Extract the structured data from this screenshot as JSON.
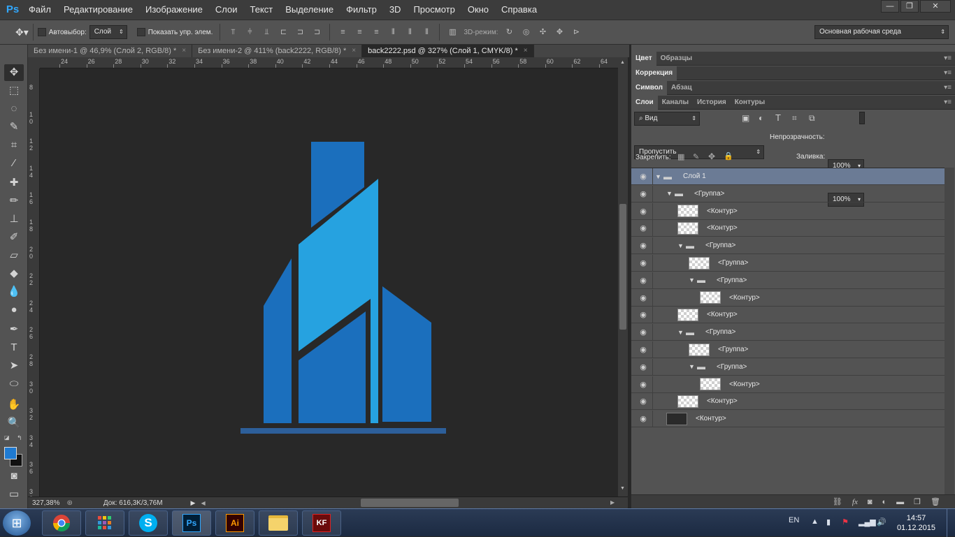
{
  "app": {
    "logo": "Ps",
    "menu": [
      "Файл",
      "Редактирование",
      "Изображение",
      "Слои",
      "Текст",
      "Выделение",
      "Фильтр",
      "3D",
      "Просмотр",
      "Окно",
      "Справка"
    ]
  },
  "options": {
    "autoselect_label": "Автовыбор:",
    "autoselect_value": "Слой",
    "show_transform_label": "Показать упр. элем.",
    "mode3d_label": "3D-режим:",
    "workspace": "Основная рабочая среда"
  },
  "tabs": [
    {
      "label": "Без имени-1 @ 46,9% (Слой 2, RGB/8) *",
      "close": "×"
    },
    {
      "label": "Без имени-2 @ 411% (back2222, RGB/8) *",
      "close": "×"
    },
    {
      "label": "back2222.psd @ 327% (Слой 1, CMYK/8) *",
      "close": "×"
    }
  ],
  "ruler": {
    "top": [
      "24",
      "26",
      "28",
      "30",
      "32",
      "34",
      "36",
      "38",
      "40",
      "42",
      "44",
      "46",
      "48",
      "50",
      "52",
      "54",
      "56",
      "58",
      "60",
      "62",
      "64"
    ],
    "left": [
      "8",
      "1\n0",
      "1\n2",
      "1\n4",
      "1\n6",
      "1\n8",
      "2\n0",
      "2\n2",
      "2\n4",
      "2\n6",
      "2\n8",
      "3\n0",
      "3\n2",
      "3\n4",
      "3\n6",
      "3\n8"
    ]
  },
  "status": {
    "zoom": "327,38%",
    "doc": "Док: 616,3K/3,76M"
  },
  "panels": {
    "color_tabs": [
      "Цвет",
      "Образцы"
    ],
    "adjust_tabs": [
      "Коррекция"
    ],
    "char_tabs": [
      "Символ",
      "Абзац"
    ],
    "layer_tabs": [
      "Слои",
      "Каналы",
      "История",
      "Контуры"
    ],
    "filter_kind": "Вид",
    "blend_mode": "Пропустить",
    "opacity_label": "Непрозрачность:",
    "opacity_value": "100%",
    "lock_label": "Закрепить:",
    "fill_label": "Заливка:",
    "fill_value": "100%"
  },
  "layers": [
    {
      "name": "Слой 1",
      "type": "folder",
      "depth": 0,
      "open": true,
      "selected": true
    },
    {
      "name": "<Группа>",
      "type": "folder",
      "depth": 1,
      "open": true
    },
    {
      "name": "<Контур>",
      "type": "layer",
      "depth": 2
    },
    {
      "name": "<Контур>",
      "type": "layer",
      "depth": 2
    },
    {
      "name": "<Группа>",
      "type": "folder",
      "depth": 2,
      "open": true
    },
    {
      "name": "<Группа>",
      "type": "layer",
      "depth": 3
    },
    {
      "name": "<Группа>",
      "type": "folder",
      "depth": 3,
      "open": true
    },
    {
      "name": "<Контур>",
      "type": "layer",
      "depth": 4
    },
    {
      "name": "<Контур>",
      "type": "layer",
      "depth": 2
    },
    {
      "name": "<Группа>",
      "type": "folder",
      "depth": 2,
      "open": true
    },
    {
      "name": "<Группа>",
      "type": "layer",
      "depth": 3
    },
    {
      "name": "<Группа>",
      "type": "folder",
      "depth": 3,
      "open": true
    },
    {
      "name": "<Контур>",
      "type": "layer",
      "depth": 4
    },
    {
      "name": "<Контур>",
      "type": "layer",
      "depth": 2
    },
    {
      "name": "<Контур>",
      "type": "layer",
      "depth": 1,
      "dark": true
    }
  ],
  "taskbar": {
    "lang": "EN",
    "time": "14:57",
    "date": "01.12.2015",
    "apps": [
      "chrome",
      "metro",
      "skype",
      "Ps",
      "Ai",
      "folder",
      "KF"
    ]
  },
  "colors": {
    "fg": "#1f7ad1",
    "bg": "#111111",
    "logo_dark": "#1b6fbd",
    "logo_light": "#26a2e0",
    "logo_base": "#2d5f9a"
  }
}
